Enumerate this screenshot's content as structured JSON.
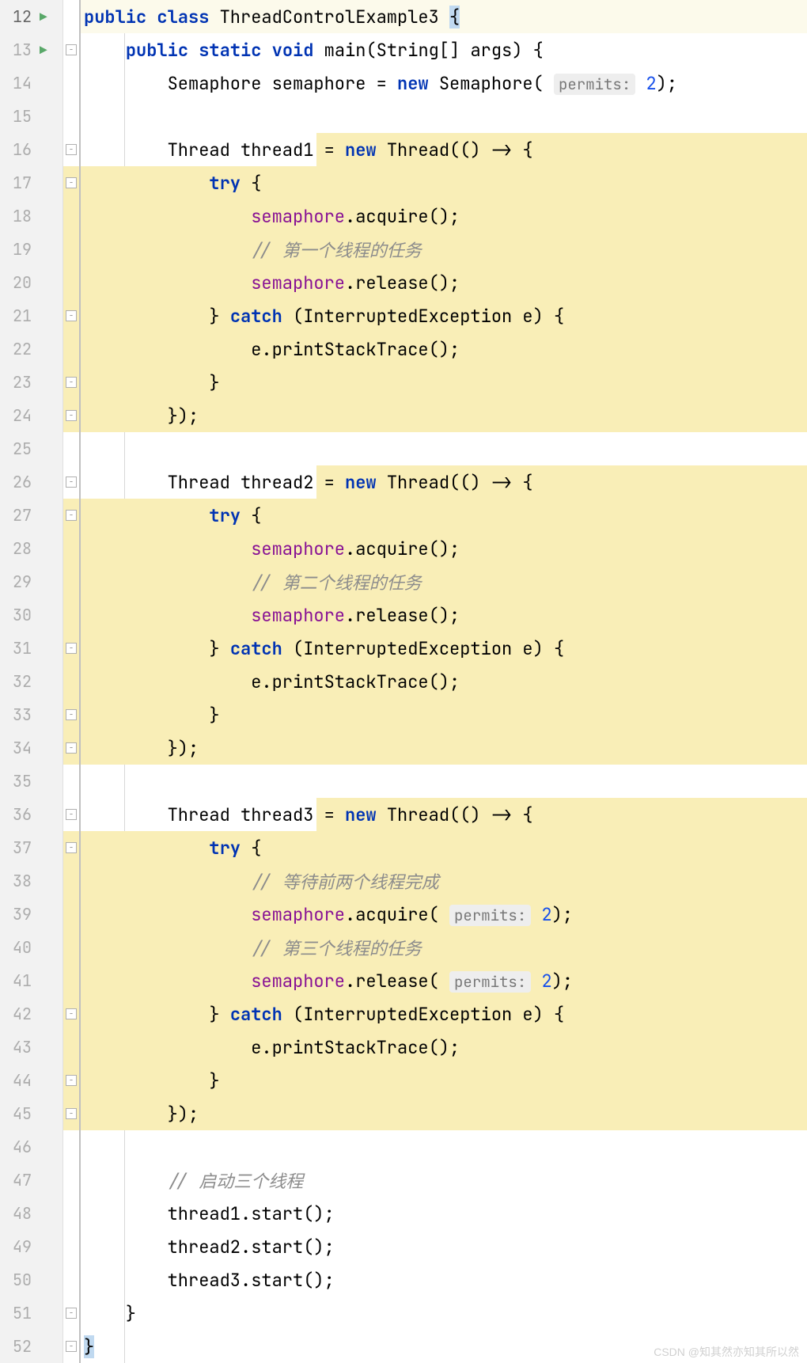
{
  "lines": [
    {
      "num": 12,
      "run": true,
      "fold": "",
      "currentLine": true,
      "hlStart": null,
      "tokens": [
        {
          "t": "kw",
          "v": "public class"
        },
        {
          "t": "type",
          "v": " ThreadControlExample3 "
        },
        {
          "t": "cursor-hl",
          "v": "{"
        }
      ],
      "indent": 0
    },
    {
      "num": 13,
      "run": true,
      "fold": "open",
      "hlStart": null,
      "tokens": [
        {
          "t": "plain",
          "v": "    "
        },
        {
          "t": "kw",
          "v": "public static void"
        },
        {
          "t": "method",
          "v": " main"
        },
        {
          "t": "punct",
          "v": "(String[] args) {"
        }
      ]
    },
    {
      "num": 14,
      "fold": "",
      "tokens": [
        {
          "t": "plain",
          "v": "        Semaphore semaphore = "
        },
        {
          "t": "kw",
          "v": "new"
        },
        {
          "t": "plain",
          "v": " Semaphore( "
        },
        {
          "t": "hint",
          "v": "permits:"
        },
        {
          "t": "plain",
          "v": " "
        },
        {
          "t": "num",
          "v": "2"
        },
        {
          "t": "punct",
          "v": ");"
        }
      ]
    },
    {
      "num": 15,
      "tokens": []
    },
    {
      "num": 16,
      "fold": "open",
      "hlFrom": 318,
      "tokens": [
        {
          "t": "plain",
          "v": "        Thread thread1 = "
        },
        {
          "t": "kw",
          "v": "new"
        },
        {
          "t": "plain",
          "v": " Thread(() -> {"
        }
      ]
    },
    {
      "num": 17,
      "fold": "open",
      "hlFrom": 20,
      "tokens": [
        {
          "t": "plain",
          "v": "            "
        },
        {
          "t": "kw",
          "v": "try"
        },
        {
          "t": "punct",
          "v": " {"
        }
      ]
    },
    {
      "num": 18,
      "hlFrom": 20,
      "tokens": [
        {
          "t": "plain",
          "v": "                "
        },
        {
          "t": "field",
          "v": "semaphore"
        },
        {
          "t": "punct",
          "v": ".acquire();"
        }
      ]
    },
    {
      "num": 19,
      "hlFrom": 20,
      "tokens": [
        {
          "t": "plain",
          "v": "                "
        },
        {
          "t": "comment",
          "v": "// 第一个线程的任务"
        }
      ]
    },
    {
      "num": 20,
      "hlFrom": 20,
      "tokens": [
        {
          "t": "plain",
          "v": "                "
        },
        {
          "t": "field",
          "v": "semaphore"
        },
        {
          "t": "punct",
          "v": ".release();"
        }
      ]
    },
    {
      "num": 21,
      "fold": "close",
      "hlFrom": 20,
      "tokens": [
        {
          "t": "plain",
          "v": "            } "
        },
        {
          "t": "kw",
          "v": "catch"
        },
        {
          "t": "punct",
          "v": " (InterruptedException e) {"
        }
      ]
    },
    {
      "num": 22,
      "hlFrom": 20,
      "tokens": [
        {
          "t": "plain",
          "v": "                e.printStackTrace();"
        }
      ]
    },
    {
      "num": 23,
      "fold": "close",
      "hlFrom": 20,
      "tokens": [
        {
          "t": "plain",
          "v": "            }"
        }
      ]
    },
    {
      "num": 24,
      "fold": "close",
      "hlFrom": 20,
      "tokens": [
        {
          "t": "plain",
          "v": "        });"
        }
      ]
    },
    {
      "num": 25,
      "tokens": []
    },
    {
      "num": 26,
      "fold": "open",
      "hlFrom": 318,
      "tokens": [
        {
          "t": "plain",
          "v": "        Thread thread2 = "
        },
        {
          "t": "kw",
          "v": "new"
        },
        {
          "t": "plain",
          "v": " Thread(() -> {"
        }
      ]
    },
    {
      "num": 27,
      "fold": "open",
      "hlFrom": 20,
      "tokens": [
        {
          "t": "plain",
          "v": "            "
        },
        {
          "t": "kw",
          "v": "try"
        },
        {
          "t": "punct",
          "v": " {"
        }
      ]
    },
    {
      "num": 28,
      "hlFrom": 20,
      "tokens": [
        {
          "t": "plain",
          "v": "                "
        },
        {
          "t": "field",
          "v": "semaphore"
        },
        {
          "t": "punct",
          "v": ".acquire();"
        }
      ]
    },
    {
      "num": 29,
      "hlFrom": 20,
      "tokens": [
        {
          "t": "plain",
          "v": "                "
        },
        {
          "t": "comment",
          "v": "// 第二个线程的任务"
        }
      ]
    },
    {
      "num": 30,
      "hlFrom": 20,
      "tokens": [
        {
          "t": "plain",
          "v": "                "
        },
        {
          "t": "field",
          "v": "semaphore"
        },
        {
          "t": "punct",
          "v": ".release();"
        }
      ]
    },
    {
      "num": 31,
      "fold": "close",
      "hlFrom": 20,
      "tokens": [
        {
          "t": "plain",
          "v": "            } "
        },
        {
          "t": "kw",
          "v": "catch"
        },
        {
          "t": "punct",
          "v": " (InterruptedException e) {"
        }
      ]
    },
    {
      "num": 32,
      "hlFrom": 20,
      "tokens": [
        {
          "t": "plain",
          "v": "                e.printStackTrace();"
        }
      ]
    },
    {
      "num": 33,
      "fold": "close",
      "hlFrom": 20,
      "tokens": [
        {
          "t": "plain",
          "v": "            }"
        }
      ]
    },
    {
      "num": 34,
      "fold": "close",
      "hlFrom": 20,
      "tokens": [
        {
          "t": "plain",
          "v": "        });"
        }
      ]
    },
    {
      "num": 35,
      "tokens": []
    },
    {
      "num": 36,
      "fold": "open",
      "hlFrom": 318,
      "tokens": [
        {
          "t": "plain",
          "v": "        Thread thread3 = "
        },
        {
          "t": "kw",
          "v": "new"
        },
        {
          "t": "plain",
          "v": " Thread(() -> {"
        }
      ]
    },
    {
      "num": 37,
      "fold": "open",
      "hlFrom": 20,
      "tokens": [
        {
          "t": "plain",
          "v": "            "
        },
        {
          "t": "kw",
          "v": "try"
        },
        {
          "t": "punct",
          "v": " {"
        }
      ]
    },
    {
      "num": 38,
      "hlFrom": 20,
      "tokens": [
        {
          "t": "plain",
          "v": "                "
        },
        {
          "t": "comment",
          "v": "// 等待前两个线程完成"
        }
      ]
    },
    {
      "num": 39,
      "hlFrom": 20,
      "tokens": [
        {
          "t": "plain",
          "v": "                "
        },
        {
          "t": "field",
          "v": "semaphore"
        },
        {
          "t": "punct",
          "v": ".acquire( "
        },
        {
          "t": "hint",
          "v": "permits:"
        },
        {
          "t": "plain",
          "v": " "
        },
        {
          "t": "num",
          "v": "2"
        },
        {
          "t": "punct",
          "v": ");"
        }
      ]
    },
    {
      "num": 40,
      "hlFrom": 20,
      "tokens": [
        {
          "t": "plain",
          "v": "                "
        },
        {
          "t": "comment",
          "v": "// 第三个线程的任务"
        }
      ]
    },
    {
      "num": 41,
      "hlFrom": 20,
      "tokens": [
        {
          "t": "plain",
          "v": "                "
        },
        {
          "t": "field",
          "v": "semaphore"
        },
        {
          "t": "punct",
          "v": ".release( "
        },
        {
          "t": "hint",
          "v": "permits:"
        },
        {
          "t": "plain",
          "v": " "
        },
        {
          "t": "num",
          "v": "2"
        },
        {
          "t": "punct",
          "v": ");"
        }
      ]
    },
    {
      "num": 42,
      "fold": "close",
      "hlFrom": 20,
      "tokens": [
        {
          "t": "plain",
          "v": "            } "
        },
        {
          "t": "kw",
          "v": "catch"
        },
        {
          "t": "punct",
          "v": " (InterruptedException e) {"
        }
      ]
    },
    {
      "num": 43,
      "hlFrom": 20,
      "tokens": [
        {
          "t": "plain",
          "v": "                e.printStackTrace();"
        }
      ]
    },
    {
      "num": 44,
      "fold": "close",
      "hlFrom": 20,
      "tokens": [
        {
          "t": "plain",
          "v": "            }"
        }
      ]
    },
    {
      "num": 45,
      "fold": "close",
      "hlFrom": 20,
      "tokens": [
        {
          "t": "plain",
          "v": "        });"
        }
      ]
    },
    {
      "num": 46,
      "tokens": []
    },
    {
      "num": 47,
      "tokens": [
        {
          "t": "plain",
          "v": "        "
        },
        {
          "t": "comment",
          "v": "// 启动三个线程"
        }
      ]
    },
    {
      "num": 48,
      "tokens": [
        {
          "t": "plain",
          "v": "        thread1.start();"
        }
      ]
    },
    {
      "num": 49,
      "tokens": [
        {
          "t": "plain",
          "v": "        thread2.start();"
        }
      ]
    },
    {
      "num": 50,
      "tokens": [
        {
          "t": "plain",
          "v": "        thread3.start();"
        }
      ]
    },
    {
      "num": 51,
      "fold": "close",
      "tokens": [
        {
          "t": "plain",
          "v": "    }"
        }
      ]
    },
    {
      "num": 52,
      "fold": "close",
      "tokens": [
        {
          "t": "cursor-hl",
          "v": "}"
        }
      ]
    }
  ],
  "watermark": "CSDN @知其然亦知其所以然"
}
